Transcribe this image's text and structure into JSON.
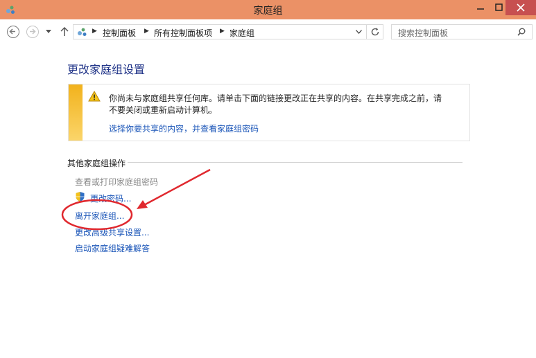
{
  "window": {
    "title": "家庭组"
  },
  "address": {
    "crumbs": [
      "控制面板",
      "所有控制面板项",
      "家庭组"
    ],
    "search_placeholder": "搜索控制面板"
  },
  "page": {
    "heading": "更改家庭组设置",
    "warning_line1": "你尚未与家庭组共享任何库。请单击下面的链接更改正在共享的内容。在共享完成之前，请",
    "warning_line2": "不要关闭或重新启动计算机。",
    "warning_link": "选择你要共享的内容，并查看家庭组密码",
    "section_title": "其他家庭组操作",
    "tasks": {
      "view_print_password": "查看或打印家庭组密码",
      "change_password": "更改密码...",
      "leave_homegroup": "离开家庭组...",
      "advanced_sharing": "更改高级共享设置...",
      "troubleshooter": "启动家庭组疑难解答"
    }
  },
  "colors": {
    "titlebar": "#eb9166",
    "heading": "#1e3287",
    "link": "#1a55b8",
    "annotation": "#e0282e"
  }
}
